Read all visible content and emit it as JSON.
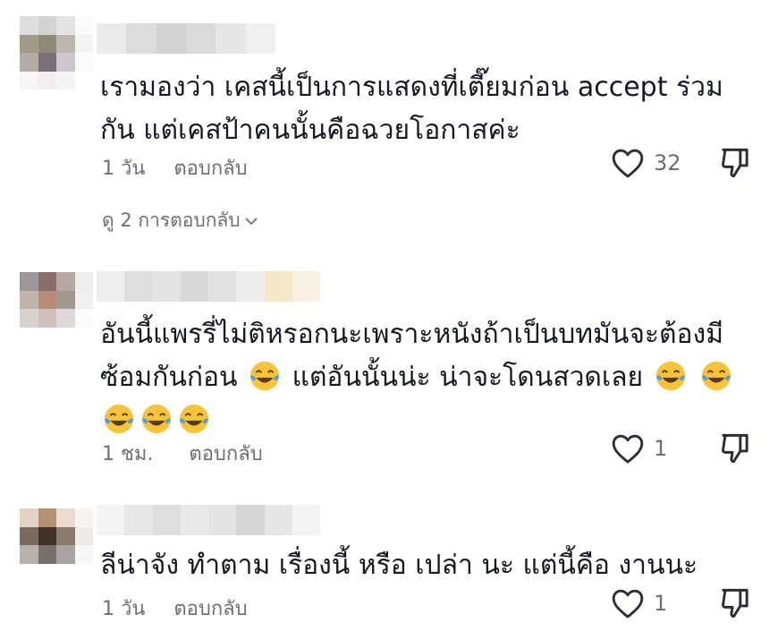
{
  "comments": [
    {
      "text_line1": "เรามองว่า เคสนี้เป็นการแสดงที่เตี๊ยมก่อน accept ร่วม",
      "text_line2": "กัน แต่เคสป้าคนนั้นคือฉวยโอกาสค่ะ",
      "time": "1 วัน",
      "reply_label": "ตอบกลับ",
      "like_count": "32",
      "view_replies": "ดู 2 การตอบกลับ"
    },
    {
      "text_line1": "อันนี้แพรรี่ไม่ติหรอกนะเพราะหนังถ้าเป็นบทมันจะต้องมี",
      "text_line2a": "ซ้อมกันก่อน",
      "text_line2b": "แต่อันนั้นน่ะ น่าจะโดนสวดเลย",
      "time": "1 ชม.",
      "reply_label": "ตอบกลับ",
      "like_count": "1"
    },
    {
      "text_line1": "ลีน่าจัง ทำตาม เรื่องนี้ หรือ เปล่า นะ แต่นี้คือ งานนะ",
      "time": "1 วัน",
      "reply_label": "ตอบกลับ",
      "like_count": "1"
    }
  ],
  "icons": {
    "like": "heart-outline-icon",
    "dislike": "thumbs-down-outline-icon",
    "expand": "chevron-down-icon",
    "emoji": "face-with-tears-of-joy-emoji"
  },
  "colors": {
    "text": "#161823",
    "meta": "#6e6f75",
    "emoji_face": "#f6c33b",
    "emoji_tear": "#4aa3df"
  }
}
